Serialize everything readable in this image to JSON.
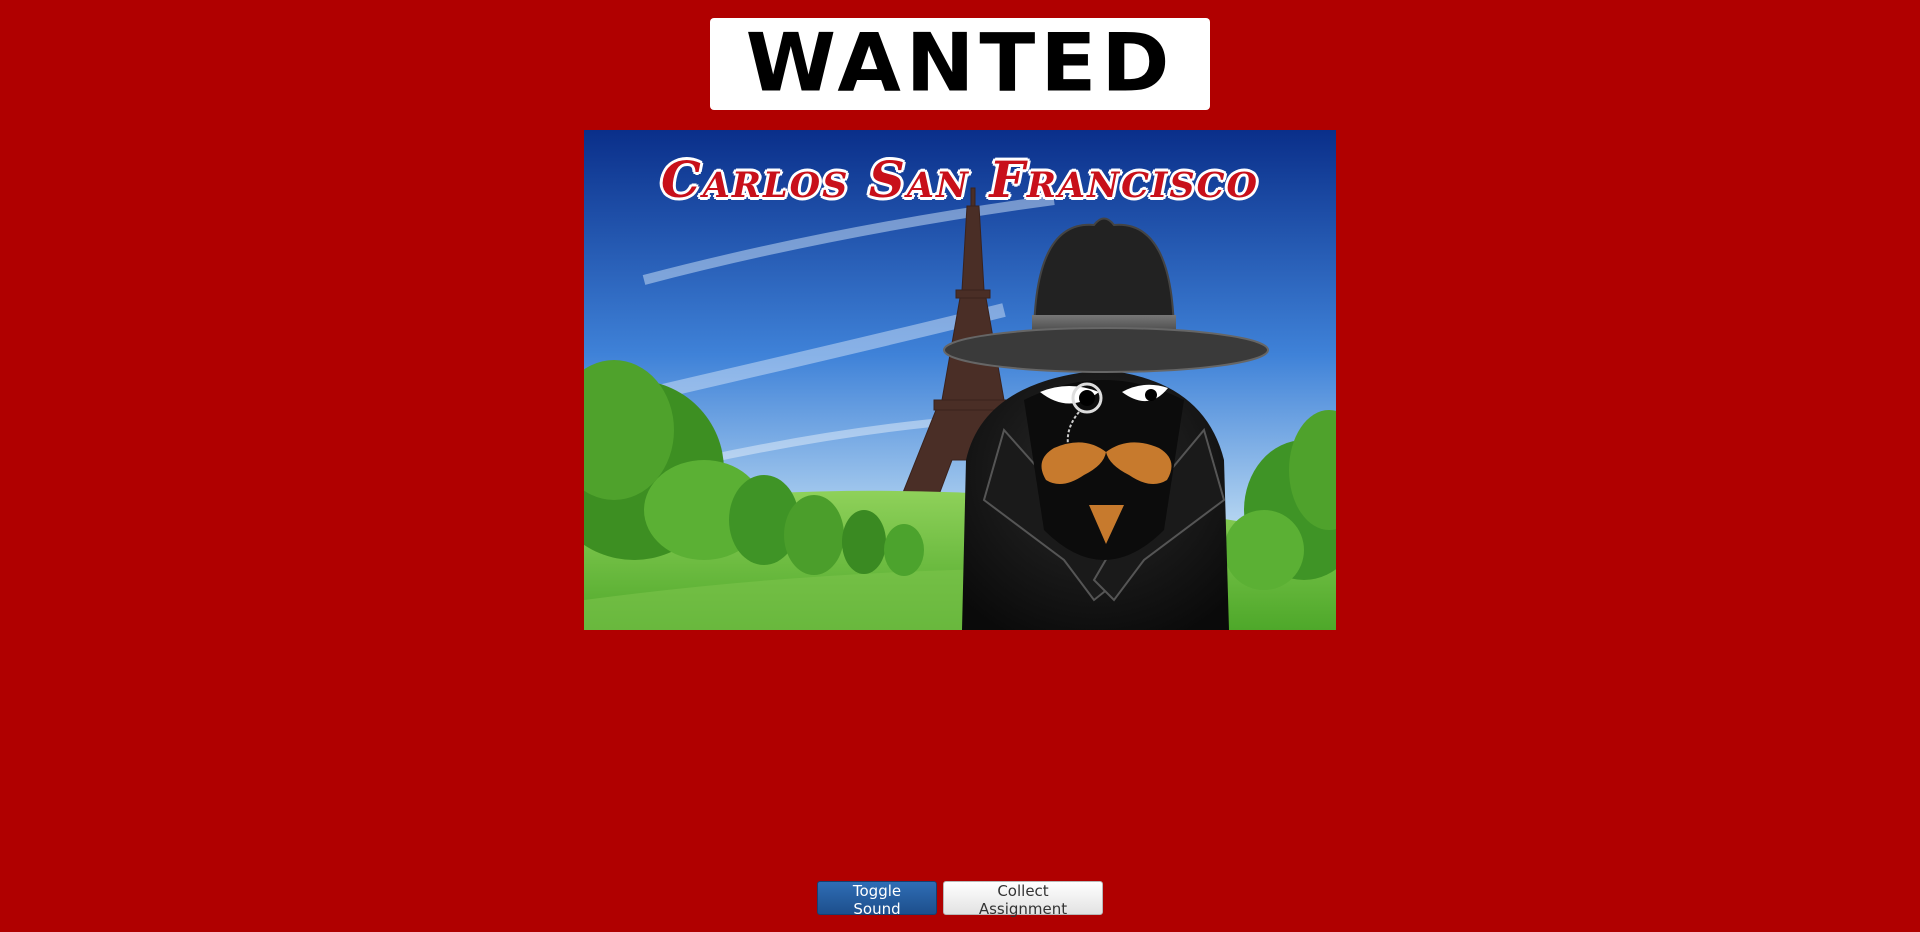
{
  "banner": {
    "title": "WANTED"
  },
  "suspect": {
    "name": "Carlos San Francisco",
    "location_scene": "Eiffel Tower, Paris"
  },
  "controls": {
    "toggle_sound_label": "Toggle Sound",
    "collect_assignment_label": "Collect Assignment"
  },
  "colors": {
    "background": "#b00000",
    "title_text": "#c8101a",
    "primary_button": "#1d4f8c"
  }
}
